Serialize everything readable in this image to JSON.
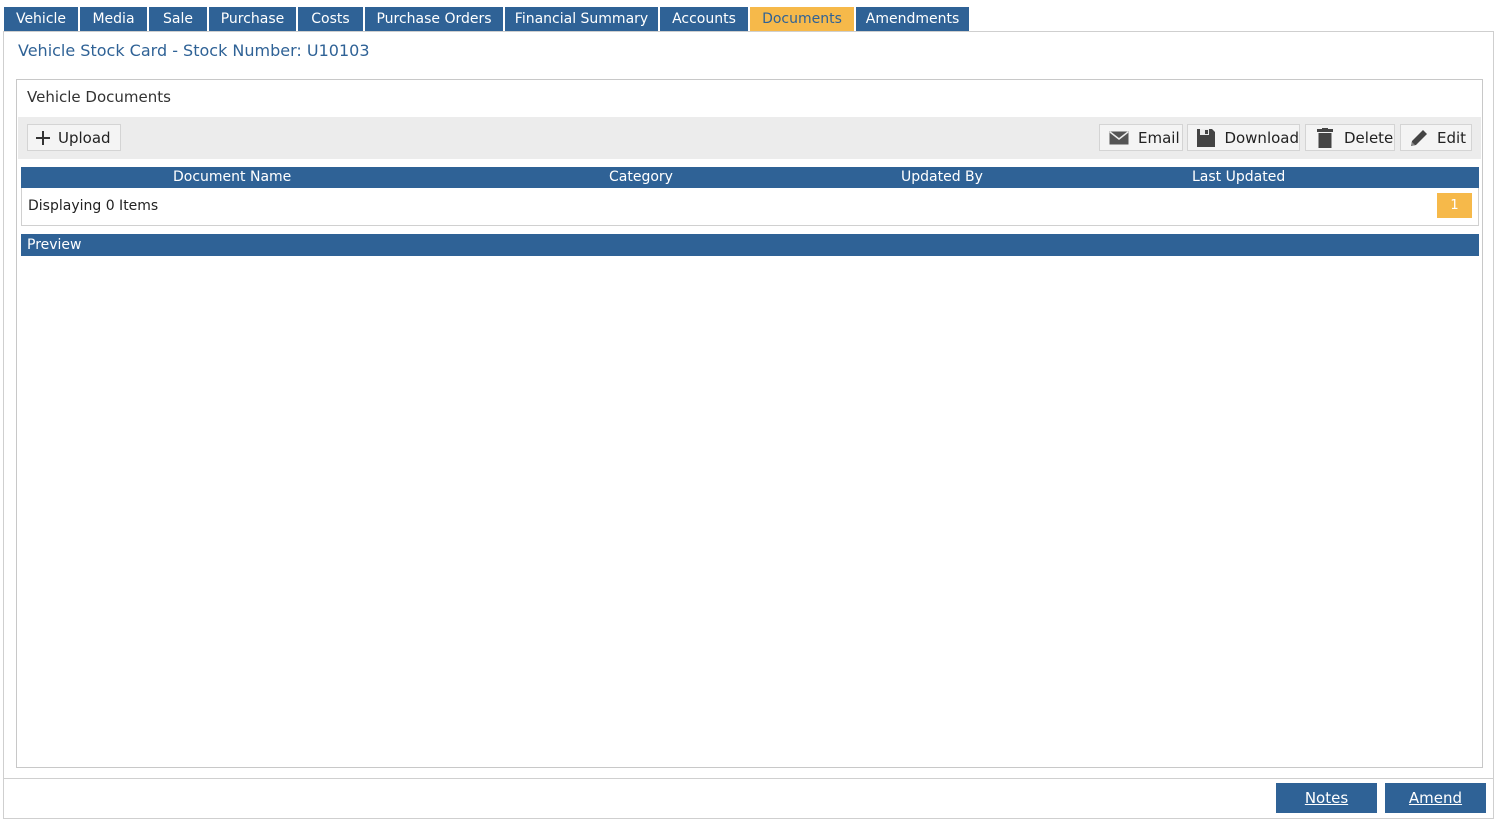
{
  "tabs": [
    "Vehicle",
    "Media",
    "Sale",
    "Purchase",
    "Costs",
    "Purchase Orders",
    "Financial Summary",
    "Accounts",
    "Documents",
    "Amendments"
  ],
  "active_tab": "Documents",
  "card_title": "Vehicle Stock Card - Stock Number: U10103",
  "panel_title": "Vehicle Documents",
  "toolbar": {
    "upload": {
      "label": "Upload",
      "icon": "plus-icon"
    },
    "email": {
      "label": "Email",
      "icon": "envelope-icon"
    },
    "download": {
      "label": "Download",
      "icon": "floppy-disk-icon"
    },
    "delete": {
      "label": "Delete",
      "icon": "trash-icon"
    },
    "edit": {
      "label": "Edit",
      "icon": "pencil-icon"
    }
  },
  "grid": {
    "columns": [
      "Document Name",
      "Category",
      "Updated By",
      "Last Updated"
    ],
    "rows": [],
    "count_text": "Displaying 0 Items",
    "current_page": "1"
  },
  "preview_title": "Preview",
  "footer": {
    "notes": "Notes",
    "amend": "Amend"
  },
  "colors": {
    "primary": "#2f6296",
    "accent": "#f6b94a",
    "toolbar_bg": "#ececec"
  }
}
